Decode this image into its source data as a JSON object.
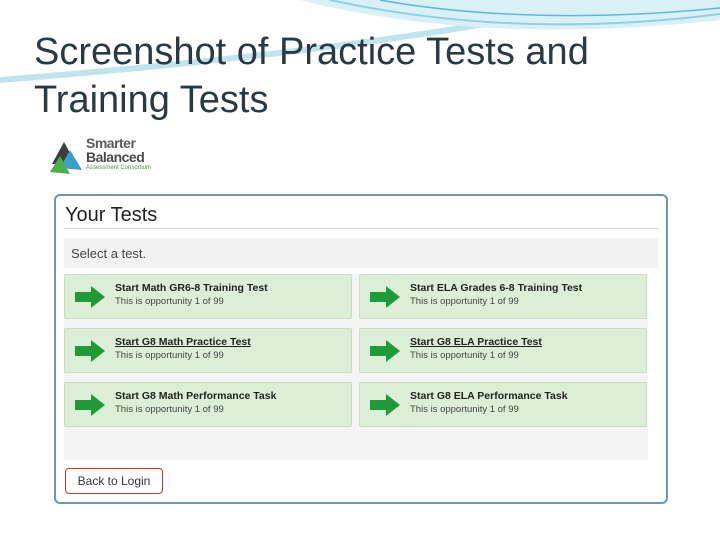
{
  "slide": {
    "title_line1": "Screenshot of Practice Tests and",
    "title_line2": "Training Tests"
  },
  "logo": {
    "word1": "Smarter",
    "word2": "Balanced",
    "subtitle": "Assessment Consortium"
  },
  "panel": {
    "title": "Your Tests",
    "select_prompt": "Select a test."
  },
  "tests": [
    {
      "label": "Start Math GR6-8 Training Test",
      "opportunity": "This is opportunity 1 of 99"
    },
    {
      "label": "Start ELA Grades 6-8 Training Test",
      "opportunity": "This is opportunity 1 of 99"
    },
    {
      "label": "Start G8 Math Practice Test",
      "opportunity": "This is opportunity 1 of 99"
    },
    {
      "label": "Start G8 ELA Practice Test",
      "opportunity": "This is opportunity 1 of 99"
    },
    {
      "label": "Start G8 Math Performance Task",
      "opportunity": "This is opportunity 1 of 99"
    },
    {
      "label": "Start G8 ELA Performance Task",
      "opportunity": "This is opportunity 1 of 99"
    }
  ],
  "back_button": "Back to Login",
  "colors": {
    "accent_blue": "#6f94b6",
    "card_green": "#dcefd6",
    "arrow_green": "#1e9a3a",
    "back_border": "#c0392b"
  },
  "icons": {
    "arrow": "right-arrow-icon",
    "logo": "smarter-balanced-logo-icon"
  }
}
